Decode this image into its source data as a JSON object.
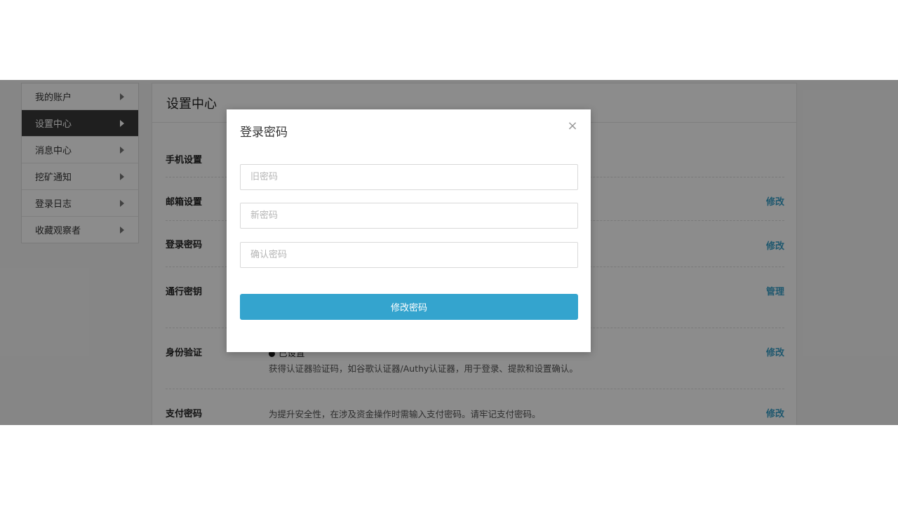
{
  "sidebar": {
    "items": [
      {
        "label": "我的账户",
        "active": false
      },
      {
        "label": "设置中心",
        "active": true
      },
      {
        "label": "消息中心",
        "active": false
      },
      {
        "label": "挖矿通知",
        "active": false
      },
      {
        "label": "登录日志",
        "active": false
      },
      {
        "label": "收藏观察者",
        "active": false
      }
    ]
  },
  "main": {
    "title": "设置中心",
    "rows": [
      {
        "label": "手机设置",
        "action": "",
        "desc": ""
      },
      {
        "label": "邮箱设置",
        "action": "修改",
        "desc": ""
      },
      {
        "label": "登录密码",
        "action": "修改",
        "desc": ""
      },
      {
        "label": "通行密钥",
        "action": "管理",
        "desc": "。"
      },
      {
        "label": "身份验证",
        "action": "修改",
        "status": "已设置",
        "desc": "获得认证器验证码，如谷歌认证器/Authy认证器，用于登录、提款和设置确认。"
      },
      {
        "label": "支付密码",
        "action": "修改",
        "desc": "为提升安全性，在涉及资金操作时需输入支付密码。请牢记支付密码。"
      }
    ]
  },
  "modal": {
    "title": "登录密码",
    "close_glyph": "×",
    "old_password_placeholder": "旧密码",
    "new_password_placeholder": "新密码",
    "confirm_password_placeholder": "确认密码",
    "submit_label": "修改密码"
  },
  "colors": {
    "accent": "#34a4ce",
    "sidebar_active": "#3a3a3a",
    "overlay": "rgba(0,0,0,0.45)"
  }
}
